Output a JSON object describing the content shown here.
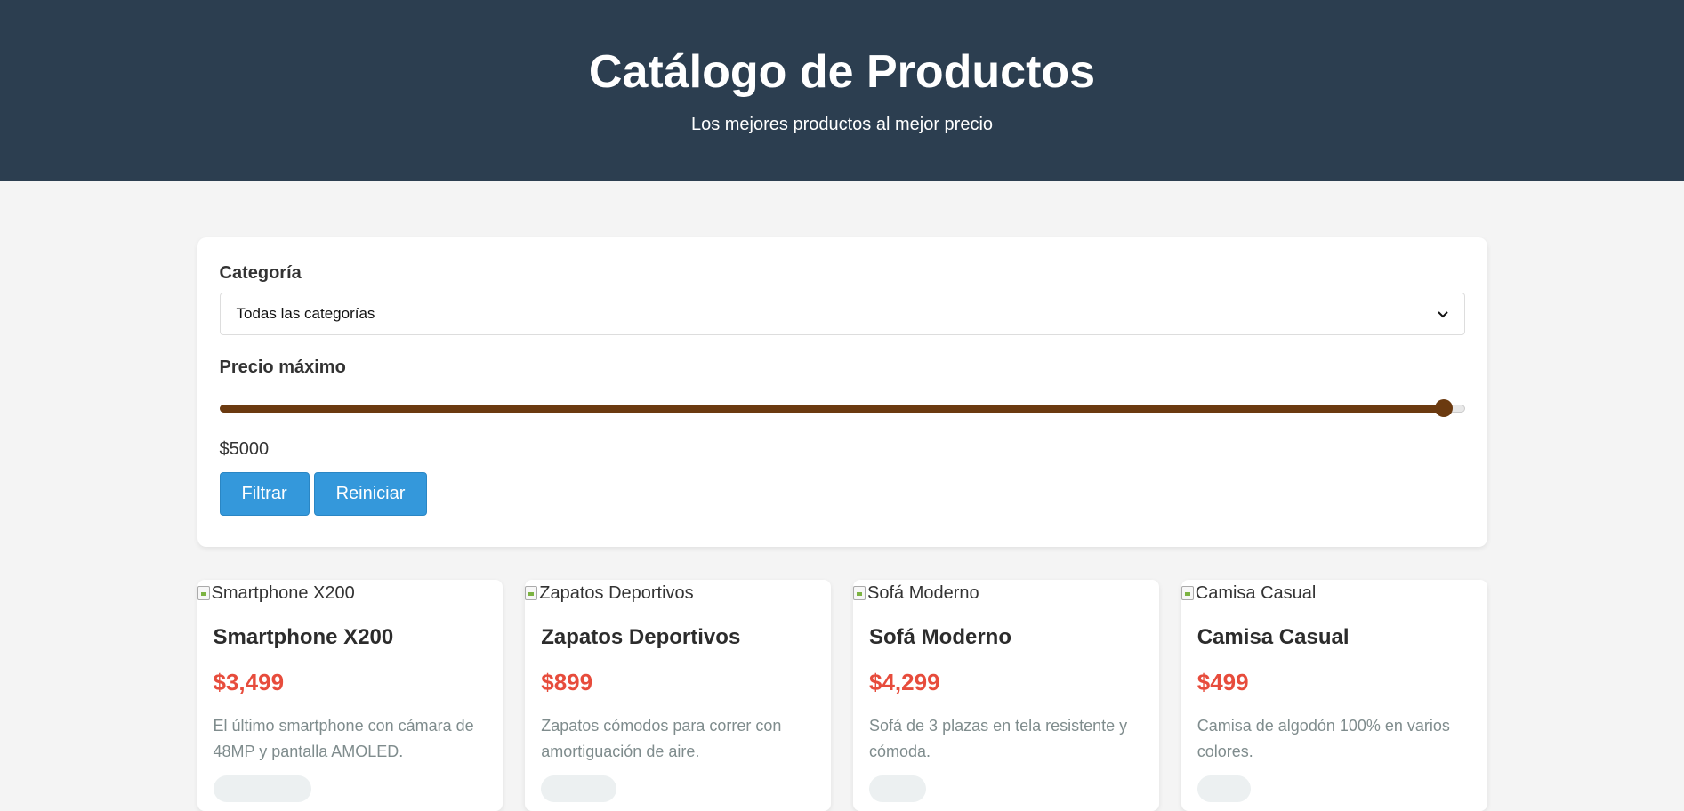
{
  "header": {
    "title": "Catálogo de Productos",
    "subtitle": "Los mejores productos al mejor precio"
  },
  "filters": {
    "category_label": "Categoría",
    "category_selected": "Todas las categorías",
    "price_label": "Precio máximo",
    "price_value": "$5000",
    "price_fraction": 0.983,
    "filter_button": "Filtrar",
    "reset_button": "Reiniciar"
  },
  "products": [
    {
      "image_alt": "Smartphone X200",
      "name": "Smartphone X200",
      "price": "$3,499",
      "description": "El último smartphone con cámara de 48MP y pantalla AMOLED."
    },
    {
      "image_alt": "Zapatos Deportivos",
      "name": "Zapatos Deportivos",
      "price": "$899",
      "description": "Zapatos cómodos para correr con amortiguación de aire."
    },
    {
      "image_alt": "Sofá Moderno",
      "name": "Sofá Moderno",
      "price": "$4,299",
      "description": "Sofá de 3 plazas en tela resistente y cómoda."
    },
    {
      "image_alt": "Camisa Casual",
      "name": "Camisa Casual",
      "price": "$499",
      "description": "Camisa de algodón 100% en varios colores."
    }
  ],
  "colors": {
    "header_bg": "#2c3e50",
    "accent": "#3498db",
    "price": "#e74c3c",
    "slider": "#6b3a10"
  }
}
